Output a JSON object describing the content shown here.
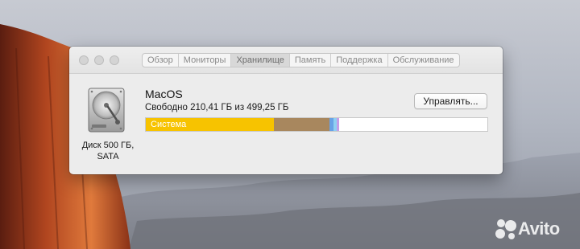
{
  "window": {
    "tabs": [
      {
        "label": "Обзор",
        "active": false
      },
      {
        "label": "Мониторы",
        "active": false
      },
      {
        "label": "Хранилище",
        "active": true
      },
      {
        "label": "Память",
        "active": false
      },
      {
        "label": "Поддержка",
        "active": false
      },
      {
        "label": "Обслуживание",
        "active": false
      }
    ]
  },
  "storage": {
    "disk_label": "Диск 500 ГБ, SATA",
    "volume_name": "MacOS",
    "free_text": "Свободно 210,41 ГБ из 499,25 ГБ",
    "manage_button": "Управлять...",
    "bar": {
      "hover_label": "Система",
      "segments": [
        {
          "name": "system",
          "fraction": 0.376,
          "color": "#f7c300"
        },
        {
          "name": "other",
          "fraction": 0.162,
          "color": "#a8875e"
        },
        {
          "name": "apps",
          "fraction": 0.012,
          "color": "#69a2e6"
        },
        {
          "name": "photos",
          "fraction": 0.01,
          "color": "#8fd0f2"
        },
        {
          "name": "music",
          "fraction": 0.005,
          "color": "#c59ee8"
        },
        {
          "name": "free",
          "fraction": 0.435,
          "color": "#ffffff"
        }
      ]
    }
  },
  "watermark": {
    "text": "Avito"
  }
}
